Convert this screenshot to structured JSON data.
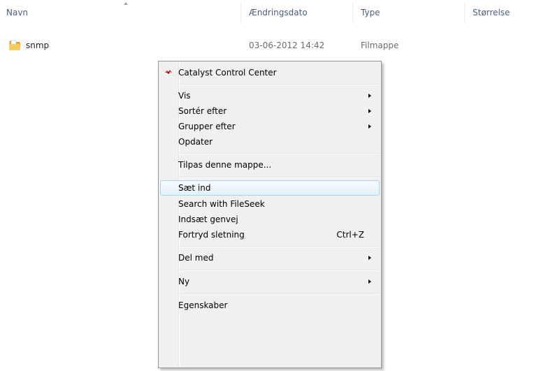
{
  "columns": {
    "name": "Navn",
    "date": "Ændringsdato",
    "type": "Type",
    "size": "Størrelse"
  },
  "files": [
    {
      "name": "snmp",
      "date": "03-06-2012 14:42",
      "type": "Filmappe",
      "icon": "folder-icon"
    }
  ],
  "context_menu": {
    "items": [
      {
        "label": "Catalyst Control Center",
        "icon": "catalyst-control-center-icon"
      },
      {
        "label": "Vis",
        "submenu": true
      },
      {
        "label": "Sortér efter",
        "submenu": true
      },
      {
        "label": "Grupper efter",
        "submenu": true
      },
      {
        "label": "Opdater"
      },
      {
        "label": "Tilpas denne mappe..."
      },
      {
        "label": "Sæt ind",
        "highlighted": true
      },
      {
        "label": "Search with FileSeek"
      },
      {
        "label": "Indsæt genvej"
      },
      {
        "label": "Fortryd sletning",
        "shortcut": "Ctrl+Z"
      },
      {
        "label": "Del med",
        "submenu": true
      },
      {
        "label": "Ny",
        "submenu": true
      },
      {
        "label": "Egenskaber"
      }
    ]
  },
  "colors": {
    "header_text": "#4c607a",
    "secondary_text": "#6d6d6d",
    "menu_background": "#f0f0f0",
    "menu_highlight_border": "#a8d8eb",
    "folder_yellow": "#f5c842"
  }
}
